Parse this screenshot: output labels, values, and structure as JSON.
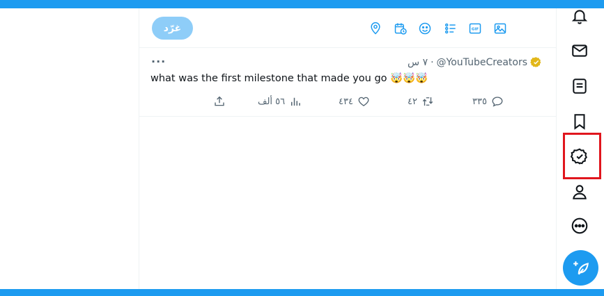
{
  "colors": {
    "accent": "#1d9bf0",
    "reply_disabled": "#8ecdf8",
    "highlight": "#e0161d",
    "muted": "#536471",
    "verified_gold": "#e2b719"
  },
  "composer": {
    "reply_label": "غرّد",
    "tools": [
      "location-icon",
      "schedule-icon",
      "emoji-icon",
      "poll-icon",
      "gif-icon",
      "image-icon"
    ]
  },
  "tweet": {
    "handle": "@YouTubeCreators",
    "separator": "·",
    "time": "٧ س",
    "text": "what was the first milestone that made you go 🤯🤯🤯",
    "more": "···",
    "actions": {
      "replies": "٣٣٥",
      "retweets": "٤٢",
      "likes": "٤٣٤",
      "views": "٥٦ ألف"
    }
  },
  "rail": {
    "items": [
      "notifications-icon",
      "messages-icon",
      "lists-icon",
      "bookmarks-icon",
      "verified-icon",
      "profile-icon",
      "more-icon"
    ],
    "fab": "compose-icon"
  }
}
